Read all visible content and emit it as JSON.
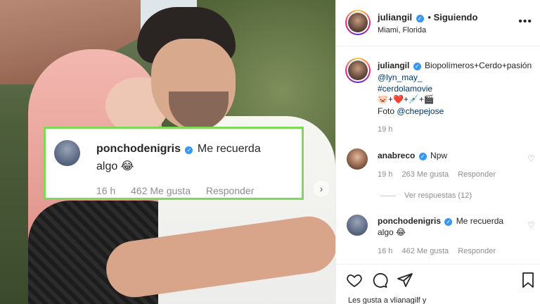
{
  "post": {
    "author": "juliangil",
    "follow_status": "Siguiendo",
    "location": "Miami, Florida",
    "caption": {
      "text": "Biopolímeros+Cerdo+pasión",
      "mention": "@lyn_may_",
      "hashtag": "#cerdolamovie",
      "emoji_line": "🐷+❤️+💉+🎬",
      "photo_credit_label": "Foto",
      "photo_credit_user": "@chepejose"
    },
    "time": "19 h"
  },
  "highlight": {
    "user": "ponchodenigris",
    "text_line1": "Me recuerda",
    "text_line2": "algo 😂",
    "time": "16 h",
    "likes": "462 Me gusta",
    "reply": "Responder"
  },
  "comments": [
    {
      "user": "anabreco",
      "text": "Npw",
      "time": "19 h",
      "likes": "263 Me gusta",
      "reply": "Responder",
      "view_replies": "Ver respuestas (12)"
    },
    {
      "user": "ponchodenigris",
      "text_line1": "Me recuerda",
      "text_line2": "algo 😂",
      "time": "16 h",
      "likes": "462 Me gusta",
      "reply": "Responder"
    }
  ],
  "footer": {
    "likes_line": "Les gusta a vlianagilf y"
  },
  "icons": {
    "verified": "verified-badge-icon",
    "more": "more-options-icon",
    "heart": "heart-icon",
    "comment": "comment-icon",
    "share": "share-icon",
    "save": "bookmark-icon",
    "next": "chevron-right-icon"
  },
  "colors": {
    "highlight_border": "#7ed957",
    "verified": "#3897f0",
    "link": "#00376b",
    "muted": "#8e8e8e"
  }
}
